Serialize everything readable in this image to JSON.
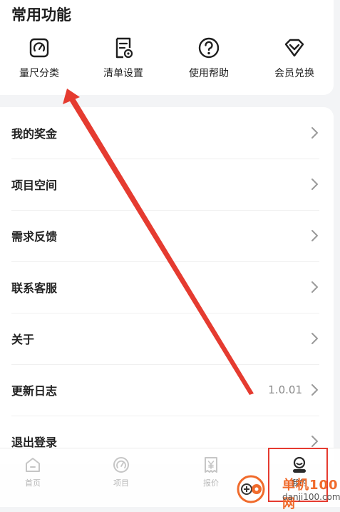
{
  "common": {
    "title": "常用功能",
    "items": [
      {
        "label": "量尺分类",
        "icon": "ruler-gauge-icon"
      },
      {
        "label": "清单设置",
        "icon": "checklist-settings-icon"
      },
      {
        "label": "使用帮助",
        "icon": "help-question-icon"
      },
      {
        "label": "会员兑换",
        "icon": "vip-diamond-icon"
      }
    ]
  },
  "list": {
    "rows": [
      {
        "label": "我的奖金"
      },
      {
        "label": "项目空间"
      },
      {
        "label": "需求反馈"
      },
      {
        "label": "联系客服"
      },
      {
        "label": "关于"
      },
      {
        "label": "更新日志",
        "value": "1.0.01"
      },
      {
        "label": "退出登录"
      }
    ]
  },
  "tabbar": {
    "tabs": [
      {
        "label": "首页",
        "icon": "home-icon"
      },
      {
        "label": "项目",
        "icon": "gauge-icon"
      },
      {
        "label": "报价",
        "icon": "yen-receipt-icon"
      },
      {
        "label": "我的",
        "icon": "user-avatar-icon"
      }
    ],
    "active_index": 3
  },
  "watermark": {
    "title": "单机100网",
    "url": "danji100.com"
  },
  "colors": {
    "annotation_red": "#e53b30",
    "watermark_orange": "#f06b2c"
  }
}
